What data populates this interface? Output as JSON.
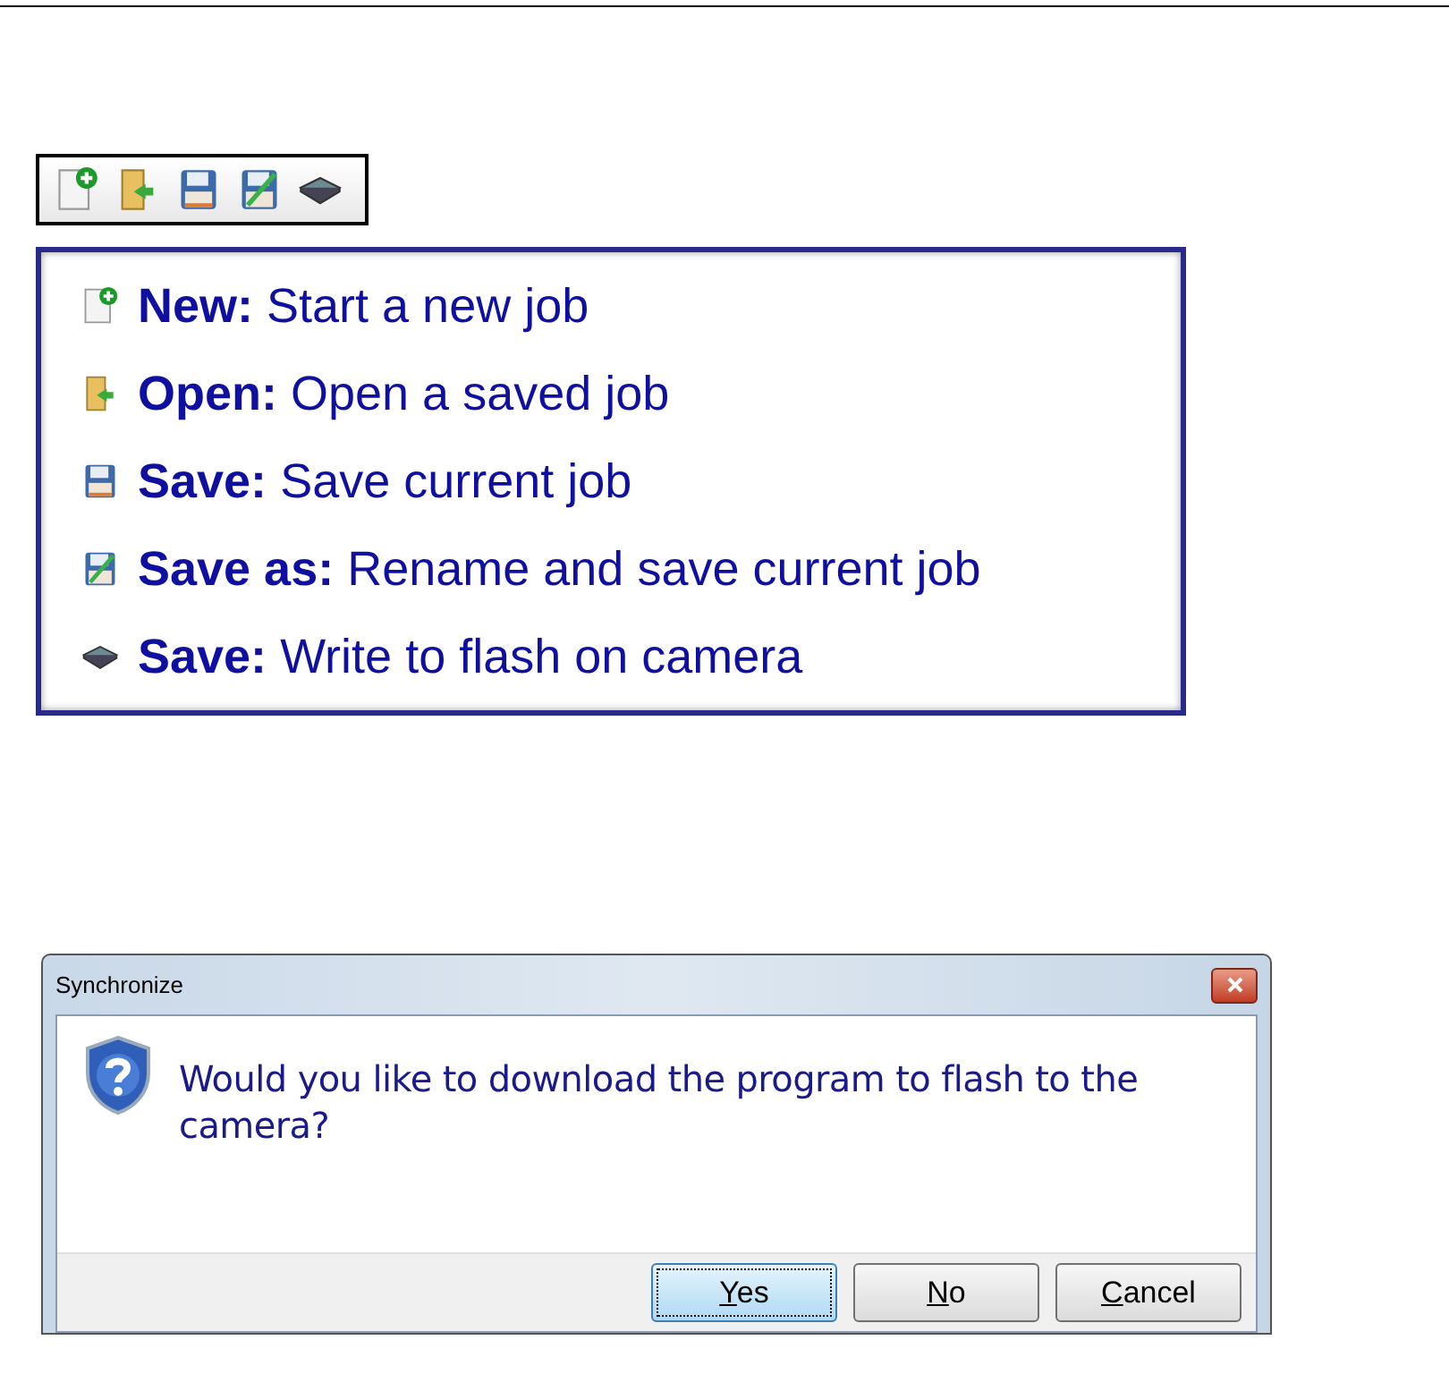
{
  "toolbar": {
    "buttons": [
      {
        "kind": "new"
      },
      {
        "kind": "open"
      },
      {
        "kind": "save"
      },
      {
        "kind": "save_as"
      },
      {
        "kind": "chip"
      }
    ]
  },
  "legend": {
    "items": [
      {
        "kind": "new",
        "text": "**New:** Start a new job"
      },
      {
        "kind": "open",
        "text": "**Open:** Open a saved job"
      },
      {
        "kind": "save",
        "text": "**Save:** Save current job"
      },
      {
        "kind": "save_as",
        "text": "**Save as:** Rename and save current job"
      },
      {
        "kind": "chip",
        "text": "**Save:** Write to flash on camera"
      }
    ]
  },
  "dialog": {
    "title": "Synchronize",
    "message": "Would you like to download the program to flash to the camera?",
    "buttons": [
      {
        "label": "Yes",
        "focused": true
      },
      {
        "label": "No",
        "focused": false
      },
      {
        "label": "Cancel",
        "focused": false
      }
    ]
  }
}
